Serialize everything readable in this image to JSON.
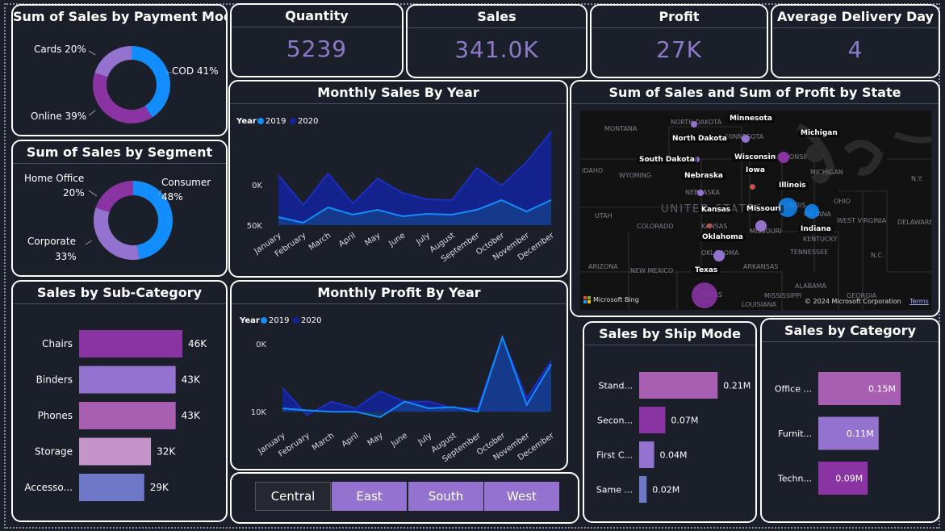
{
  "kpis": {
    "quantity": {
      "title": "Quantity",
      "value": "5239"
    },
    "sales": {
      "title": "Sales",
      "value": "341.0K"
    },
    "profit": {
      "title": "Profit",
      "value": "27K"
    },
    "avg_delivery": {
      "title": "Average Delivery Day",
      "value": "4"
    }
  },
  "payment": {
    "title": "Sum of Sales by Payment Mode",
    "labels": [
      "COD 41%",
      "Online 39%",
      "Cards 20%"
    ]
  },
  "segment": {
    "title": "Sum of Sales by Segment",
    "labels": [
      "Consumer",
      "48%",
      "Corporate",
      "33%",
      "Home Office",
      "20%"
    ]
  },
  "monthly_sales": {
    "title": "Monthly Sales By Year",
    "legend_title": "Year",
    "yticks": [
      "50K",
      "0K"
    ]
  },
  "monthly_profit": {
    "title": "Monthly Profit By Year",
    "legend_title": "Year",
    "yticks": [
      "10K",
      "0K"
    ]
  },
  "map": {
    "title": "Sum of Sales and Sum of Profit by State",
    "states": [
      "Minnesota",
      "Michigan",
      "North Dakota",
      "South Dakota",
      "Wisconsin",
      "Iowa",
      "Nebraska",
      "Illinois",
      "Kansas",
      "Missouri",
      "Indiana",
      "Oklahoma",
      "Texas"
    ],
    "bg_labels": [
      "MONTANA",
      "NORTH DAKOTA",
      "MINNESOTA",
      "WYOMING",
      "NEBRASKA",
      "WISCONSIN",
      "MICHIGAN",
      "UTAH",
      "COLORADO",
      "KANSAS",
      "MISSOURI",
      "OHIO",
      "ILLINOIS",
      "INDIANA",
      "KENTUCKY",
      "WEST VIRGINIA",
      "TENNESSEE",
      "ARIZONA",
      "NEW MEXICO",
      "OKLAHOMA",
      "ARKANSAS",
      "ALABAMA",
      "GEORGIA",
      "MISSISSIPPI",
      "TEXAS",
      "LOUISIANA",
      "UNITED STATES",
      "N.Y.",
      "N.C.",
      "DELAWARE",
      "IDAHO"
    ],
    "bing": "Microsoft Bing",
    "copyright": "© 2024 Microsoft Corporation",
    "terms": "Terms"
  },
  "slicer": {
    "items": [
      "Central",
      "East",
      "South",
      "West"
    ]
  },
  "colors": {
    "accent": "#8d7ac9",
    "series_2019": "#118dff",
    "series_2020": "#12239e",
    "purple_dark": "#8a34a3",
    "purple_mid": "#9473cf",
    "purple_rose": "#a95fb1",
    "purple_light": "#c594c8",
    "periwinkle": "#6d78c8"
  },
  "chart_data": [
    {
      "type": "pie",
      "title": "Sum of Sales by Payment Mode",
      "categories": [
        "COD",
        "Online",
        "Cards"
      ],
      "values": [
        41,
        39,
        20
      ],
      "colors": [
        "#118dff",
        "#8a34a3",
        "#9473cf"
      ]
    },
    {
      "type": "pie",
      "title": "Sum of Sales by Segment",
      "categories": [
        "Consumer",
        "Corporate",
        "Home Office"
      ],
      "values": [
        48,
        33,
        20
      ],
      "colors": [
        "#118dff",
        "#9473cf",
        "#8a34a3"
      ]
    },
    {
      "type": "area",
      "title": "Monthly Sales By Year",
      "categories": [
        "January",
        "February",
        "March",
        "April",
        "May",
        "June",
        "July",
        "August",
        "September",
        "October",
        "November",
        "December"
      ],
      "series": [
        {
          "name": "2019",
          "values": [
            10,
            3,
            22,
            13,
            19,
            11,
            14,
            13,
            19,
            31,
            17,
            31
          ]
        },
        {
          "name": "2020",
          "values": [
            62,
            25,
            64,
            27,
            58,
            40,
            32,
            31,
            71,
            49,
            78,
            116
          ]
        }
      ],
      "ylim": [
        0,
        120
      ],
      "yticks": [
        0,
        50
      ],
      "stacked": true
    },
    {
      "type": "area",
      "title": "Monthly Profit By Year",
      "categories": [
        "January",
        "February",
        "March",
        "April",
        "May",
        "June",
        "July",
        "August",
        "September",
        "October",
        "November",
        "December"
      ],
      "series": [
        {
          "name": "2019",
          "values": [
            500,
            200,
            0,
            0,
            -800,
            1500,
            500,
            700,
            0,
            11000,
            1000,
            7000
          ]
        },
        {
          "name": "2020",
          "values": [
            3500,
            -500,
            1500,
            500,
            3000,
            1500,
            1500,
            500,
            500,
            11000,
            2000,
            7500
          ]
        }
      ],
      "ylim": [
        -2000,
        13000
      ],
      "yticks": [
        0,
        10000
      ]
    },
    {
      "type": "bar",
      "title": "Sales by Sub-Category",
      "categories": [
        "Chairs",
        "Binders",
        "Phones",
        "Storage",
        "Accesso..."
      ],
      "values": [
        46,
        43,
        43,
        32,
        29
      ],
      "labels": [
        "46K",
        "43K",
        "43K",
        "32K",
        "29K"
      ],
      "xlim": [
        0,
        60
      ],
      "colors": [
        "#8a34a3",
        "#9473cf",
        "#a95fb1",
        "#c594c8",
        "#6d78c8"
      ]
    },
    {
      "type": "bar",
      "title": "Sales by Ship Mode",
      "categories": [
        "Stand...",
        "Secon...",
        "First C...",
        "Same ..."
      ],
      "values": [
        0.21,
        0.07,
        0.04,
        0.02
      ],
      "labels": [
        "0.21M",
        "0.07M",
        "0.04M",
        "0.02M"
      ],
      "xlim": [
        0,
        0.3
      ],
      "colors": [
        "#a95fb1",
        "#8a34a3",
        "#9473cf",
        "#6d78c8"
      ]
    },
    {
      "type": "bar",
      "title": "Sales by Category",
      "categories": [
        "Office ...",
        "Furnit...",
        "Techn..."
      ],
      "values": [
        0.15,
        0.11,
        0.09
      ],
      "labels": [
        "0.15M",
        "0.11M",
        "0.09M"
      ],
      "xlim": [
        0,
        0.2
      ],
      "colors": [
        "#a95fb1",
        "#9473cf",
        "#8a34a3"
      ]
    }
  ]
}
